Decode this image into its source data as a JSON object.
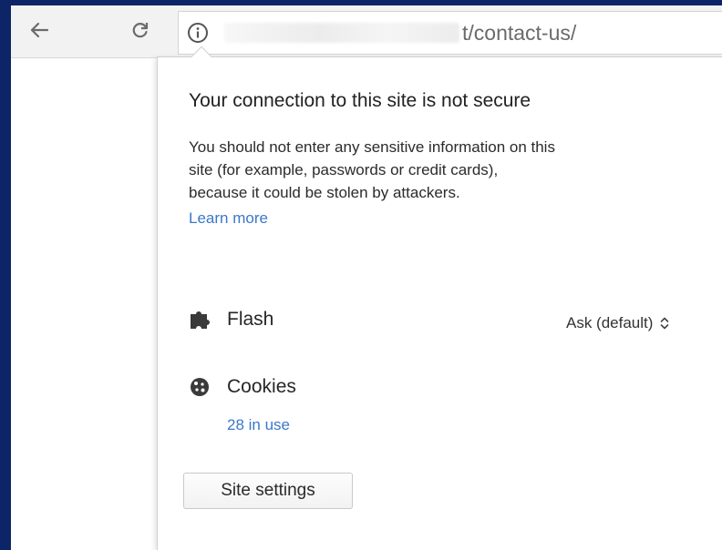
{
  "toolbar": {
    "back_icon": "arrow-left-icon",
    "reload_icon": "reload-icon",
    "info_icon": "info-circle-icon",
    "url_visible_text": "t/contact-us/"
  },
  "popup": {
    "title": "Your connection to this site is not secure",
    "description_lines": [
      "You should not enter any sensitive information on this",
      "site (for example, passwords or credit cards),",
      "because it could be stolen by attackers."
    ],
    "learn_more": "Learn more",
    "permissions": {
      "flash": {
        "icon": "puzzle-piece-icon",
        "label": "Flash",
        "value": "Ask (default)"
      },
      "cookies": {
        "icon": "cookie-icon",
        "label": "Cookies",
        "count": "28 in use"
      }
    },
    "site_settings_button": "Site settings"
  },
  "colors": {
    "desktop_background": "#0d2466",
    "link": "#3b78c9"
  }
}
